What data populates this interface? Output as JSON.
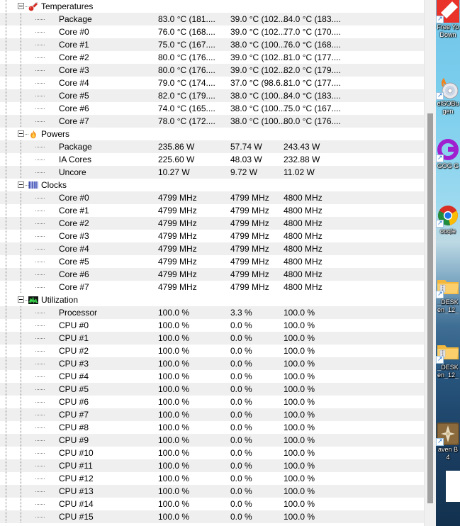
{
  "app": {
    "name": "hardware-monitor-sensor-tree",
    "colors": {
      "row_alt": "#efefef",
      "row_base": "#ffffff",
      "text": "#000000",
      "tree_line": "#808080",
      "scrollbar_track": "#f0f0f0",
      "scrollbar_thumb": "#a0a0a0"
    }
  },
  "tree": {
    "groups": [
      {
        "label": "Temperatures",
        "icon": "thermometer-icon",
        "expanded": true,
        "rows": [
          {
            "label": "Package",
            "v1": "83.0 °C  (181....",
            "v2": "39.0 °C  (102....",
            "v3": "84.0 °C  (183...."
          },
          {
            "label": "Core #0",
            "v1": "76.0 °C  (168....",
            "v2": "39.0 °C  (102....",
            "v3": "77.0 °C  (170...."
          },
          {
            "label": "Core #1",
            "v1": "75.0 °C  (167....",
            "v2": "38.0 °C  (100....",
            "v3": "76.0 °C  (168...."
          },
          {
            "label": "Core #2",
            "v1": "80.0 °C  (176....",
            "v2": "39.0 °C  (102....",
            "v3": "81.0 °C  (177...."
          },
          {
            "label": "Core #3",
            "v1": "80.0 °C  (176....",
            "v2": "39.0 °C  (102....",
            "v3": "82.0 °C  (179...."
          },
          {
            "label": "Core #4",
            "v1": "79.0 °C  (174....",
            "v2": "37.0 °C  (98.6...",
            "v3": "81.0 °C  (177...."
          },
          {
            "label": "Core #5",
            "v1": "82.0 °C  (179....",
            "v2": "38.0 °C  (100....",
            "v3": "84.0 °C  (183...."
          },
          {
            "label": "Core #6",
            "v1": "74.0 °C  (165....",
            "v2": "38.0 °C  (100....",
            "v3": "75.0 °C  (167...."
          },
          {
            "label": "Core #7",
            "v1": "78.0 °C  (172....",
            "v2": "38.0 °C  (100....",
            "v3": "80.0 °C  (176...."
          }
        ]
      },
      {
        "label": "Powers",
        "icon": "flame-icon",
        "expanded": true,
        "rows": [
          {
            "label": "Package",
            "v1": "235.86 W",
            "v2": "57.74 W",
            "v3": "243.43 W"
          },
          {
            "label": "IA Cores",
            "v1": "225.60 W",
            "v2": "48.03 W",
            "v3": "232.88 W"
          },
          {
            "label": "Uncore",
            "v1": "10.27 W",
            "v2": "9.72 W",
            "v3": "11.02 W"
          }
        ]
      },
      {
        "label": "Clocks",
        "icon": "clock-bars-icon",
        "expanded": true,
        "rows": [
          {
            "label": "Core #0",
            "v1": "4799 MHz",
            "v2": "4799 MHz",
            "v3": "4800 MHz"
          },
          {
            "label": "Core #1",
            "v1": "4799 MHz",
            "v2": "4799 MHz",
            "v3": "4800 MHz"
          },
          {
            "label": "Core #2",
            "v1": "4799 MHz",
            "v2": "4799 MHz",
            "v3": "4800 MHz"
          },
          {
            "label": "Core #3",
            "v1": "4799 MHz",
            "v2": "4799 MHz",
            "v3": "4800 MHz"
          },
          {
            "label": "Core #4",
            "v1": "4799 MHz",
            "v2": "4799 MHz",
            "v3": "4800 MHz"
          },
          {
            "label": "Core #5",
            "v1": "4799 MHz",
            "v2": "4799 MHz",
            "v3": "4800 MHz"
          },
          {
            "label": "Core #6",
            "v1": "4799 MHz",
            "v2": "4799 MHz",
            "v3": "4800 MHz"
          },
          {
            "label": "Core #7",
            "v1": "4799 MHz",
            "v2": "4799 MHz",
            "v3": "4800 MHz"
          }
        ]
      },
      {
        "label": "Utilization",
        "icon": "waveform-icon",
        "expanded": true,
        "rows": [
          {
            "label": "Processor",
            "v1": "100.0 %",
            "v2": "3.3 %",
            "v3": "100.0 %"
          },
          {
            "label": "CPU #0",
            "v1": "100.0 %",
            "v2": "0.0 %",
            "v3": "100.0 %"
          },
          {
            "label": "CPU #1",
            "v1": "100.0 %",
            "v2": "0.0 %",
            "v3": "100.0 %"
          },
          {
            "label": "CPU #2",
            "v1": "100.0 %",
            "v2": "0.0 %",
            "v3": "100.0 %"
          },
          {
            "label": "CPU #3",
            "v1": "100.0 %",
            "v2": "0.0 %",
            "v3": "100.0 %"
          },
          {
            "label": "CPU #4",
            "v1": "100.0 %",
            "v2": "0.0 %",
            "v3": "100.0 %"
          },
          {
            "label": "CPU #5",
            "v1": "100.0 %",
            "v2": "0.0 %",
            "v3": "100.0 %"
          },
          {
            "label": "CPU #6",
            "v1": "100.0 %",
            "v2": "0.0 %",
            "v3": "100.0 %"
          },
          {
            "label": "CPU #7",
            "v1": "100.0 %",
            "v2": "0.0 %",
            "v3": "100.0 %"
          },
          {
            "label": "CPU #8",
            "v1": "100.0 %",
            "v2": "0.0 %",
            "v3": "100.0 %"
          },
          {
            "label": "CPU #9",
            "v1": "100.0 %",
            "v2": "0.0 %",
            "v3": "100.0 %"
          },
          {
            "label": "CPU #10",
            "v1": "100.0 %",
            "v2": "0.0 %",
            "v3": "100.0 %"
          },
          {
            "label": "CPU #11",
            "v1": "100.0 %",
            "v2": "0.0 %",
            "v3": "100.0 %"
          },
          {
            "label": "CPU #12",
            "v1": "100.0 %",
            "v2": "0.0 %",
            "v3": "100.0 %"
          },
          {
            "label": "CPU #13",
            "v1": "100.0 %",
            "v2": "0.0 %",
            "v3": "100.0 %"
          },
          {
            "label": "CPU #14",
            "v1": "100.0 %",
            "v2": "0.0 %",
            "v3": "100.0 %"
          },
          {
            "label": "CPU #15",
            "v1": "100.0 %",
            "v2": "0.0 %",
            "v3": "100.0 %"
          }
        ]
      }
    ]
  },
  "desktop": {
    "icons": [
      {
        "name": "free-youtube-download-shortcut",
        "label1": "Free Yo",
        "label2": "Down",
        "kind": "red-tile"
      },
      {
        "name": "ultraiso-burner-shortcut",
        "label1": "elSOBu",
        "label2": "gen",
        "kind": "disc"
      },
      {
        "name": "gog-galaxy-shortcut",
        "label1": "GOG G",
        "label2": "",
        "kind": "gog"
      },
      {
        "name": "google-chrome-shortcut",
        "label1": "oogle",
        "label2": "",
        "kind": "chrome"
      },
      {
        "name": "archive-folder-shortcut",
        "label1": "_DESK",
        "label2": "en_12_",
        "kind": "folder-zip"
      },
      {
        "name": "archive-folder-shortcut-2",
        "label1": "_DESK",
        "label2": "en_12_",
        "kind": "folder-zip"
      },
      {
        "name": "game-raven-shortcut",
        "label1": "aven B",
        "label2": "4",
        "kind": "game"
      }
    ]
  }
}
